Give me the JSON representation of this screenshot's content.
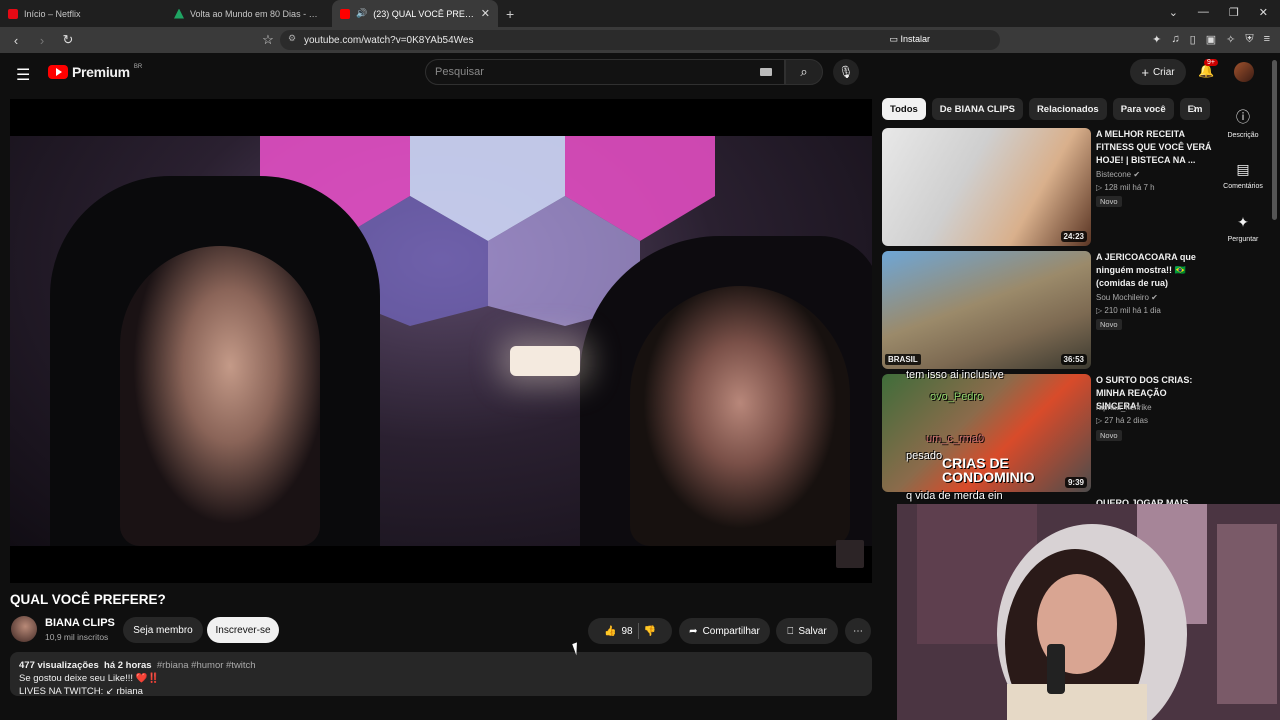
{
  "browser": {
    "tabs": [
      {
        "title": "Início – Netflix",
        "color": "#e50914"
      },
      {
        "title": "Volta ao Mundo em 80 Dias - Uma A",
        "color": "#1fa463"
      },
      {
        "title": "(23) QUAL VOCÊ PREFERE? - Y",
        "color": "#ff0000"
      }
    ],
    "url": "youtube.com/watch?v=0K8YAb54Wes",
    "install_label": "Instalar"
  },
  "yt": {
    "brand": "Premium",
    "region": "BR",
    "search_placeholder": "Pesquisar",
    "create_label": "Criar",
    "notif_count": "9+"
  },
  "video": {
    "title": "QUAL VOCÊ PREFERE?",
    "channel": "BIANA CLIPS",
    "subs": "10,9 mil inscritos",
    "member_label": "Seja membro",
    "subscribe_label": "Inscrever-se",
    "likes": "98",
    "share_label": "Compartilhar",
    "save_label": "Salvar",
    "views": "477 visualizações",
    "age": "há 2 horas",
    "tags": "#rbiana #humor #twitch",
    "desc_line1": "Se gostou deixe seu Like!!! ❤️‼️",
    "desc_line2": "LIVES  NA TWITCH:  ↙ rbiana"
  },
  "chips": [
    "Todos",
    "De BIANA CLIPS",
    "Relacionados",
    "Para você",
    "Em"
  ],
  "recs": [
    {
      "title": "A MELHOR RECEITA FITNESS QUE VOCÊ VERÁ HOJE! | BISTECA NA ...",
      "channel": "Bistecone ✔",
      "meta": "▷ 128 mil  há 7 h",
      "badge": "Novo",
      "duration": "24:23"
    },
    {
      "title": "A JERICOACOARA que ninguém mostra!! 🇧🇷 (comidas de rua)",
      "channel": "Sou Mochileiro ✔",
      "meta": "▷ 210 mil  há 1 dia",
      "badge": "Novo",
      "duration": "36:53",
      "thumb_tag": "BRASIL"
    },
    {
      "title": "O SURTO DOS CRIAS: MINHA REAÇÃO SINCERA!",
      "channel": "raphaa_henrike",
      "meta": "▷ 27  há 2 dias",
      "badge": "Novo",
      "duration": "9:39",
      "thumb_text": "CRIAS DE CONDOMINIO"
    },
    {
      "title": "QUERO JOGAR MAIS"
    }
  ],
  "rail": [
    "Descrição",
    "Comentários",
    "Perguntar"
  ],
  "overlay_chat": [
    "tem isso ai inclusive",
    "ovo_Pedro",
    "um_c_rma0",
    "pesado",
    "q vida de merda ein"
  ]
}
